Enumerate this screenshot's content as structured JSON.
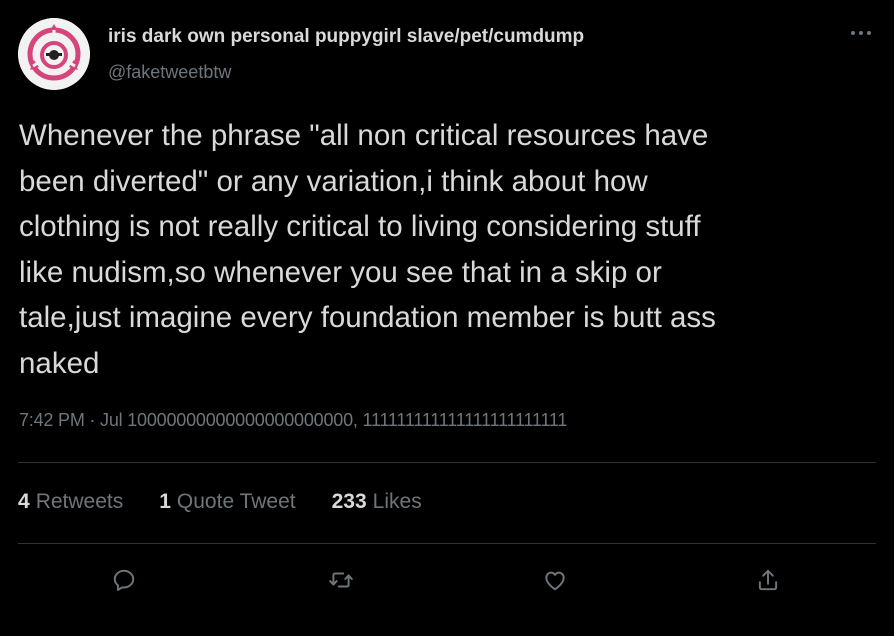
{
  "tweet": {
    "display_name": "iris dark own personal puppygirl slave/pet/cumdump",
    "handle": "@faketweetbtw",
    "text": "Whenever the phrase \"all non critical resources have\nbeen diverted\" or any variation,i think about how\nclothing is not really critical to living considering stuff\nlike nudism,so whenever you see that in a skip or\ntale,just imagine every foundation member is butt ass\nnaked",
    "timestamp": "7:42 PM · Jul 10000000000000000000000, 111111111111111111111111"
  },
  "stats": {
    "retweets_count": "4",
    "retweets_label": "Retweets",
    "quotes_count": "1",
    "quotes_label": "Quote Tweet",
    "likes_count": "233",
    "likes_label": "Likes"
  },
  "icons": {
    "avatar": "scp-foundation-logo",
    "more": "more-horizontal-icon",
    "reply": "reply-icon",
    "retweet": "retweet-icon",
    "like": "heart-icon",
    "share": "share-icon"
  },
  "colors": {
    "background": "#000000",
    "text": "#d9d9d9",
    "secondary": "#6e767d",
    "divider": "#2f3336",
    "avatar_accent": "#d5457c"
  }
}
